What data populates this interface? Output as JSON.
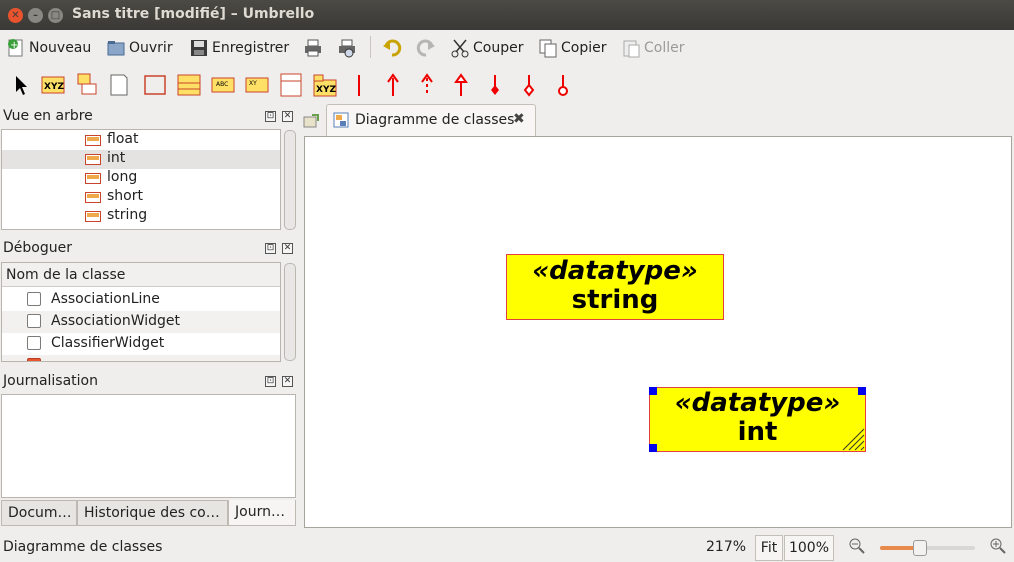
{
  "window": {
    "title": "Sans titre [modifié] – Umbrello"
  },
  "toolbar": {
    "new_label": "Nouveau",
    "open_label": "Ouvrir",
    "save_label": "Enregistrer",
    "cut_label": "Couper",
    "copy_label": "Copier",
    "paste_label": "Coller"
  },
  "tree_panel": {
    "title": "Vue en arbre",
    "items": [
      {
        "label": "float"
      },
      {
        "label": "int"
      },
      {
        "label": "long"
      },
      {
        "label": "short"
      },
      {
        "label": "string"
      }
    ]
  },
  "debug_panel": {
    "title": "Déboguer",
    "column_header": "Nom de la classe",
    "items": [
      {
        "label": "AssociationLine"
      },
      {
        "label": "AssociationWidget"
      },
      {
        "label": "ClassifierWidget"
      }
    ]
  },
  "log_panel": {
    "title": "Journalisation"
  },
  "bottom_tabs": [
    {
      "label": "Docum…"
    },
    {
      "label": "Historique des co…"
    },
    {
      "label": "Journ…"
    }
  ],
  "diagram": {
    "tab_label": "Diagramme de classes",
    "widgets": [
      {
        "stereotype": "«datatype»",
        "name": "string"
      },
      {
        "stereotype": "«datatype»",
        "name": "int"
      }
    ]
  },
  "status": {
    "text": "Diagramme de classes",
    "zoom": "217%",
    "fit_label": "Fit",
    "reset_label": "100%"
  },
  "colors": {
    "datatype_fill": "#ffff00",
    "datatype_border": "#e04040",
    "selection_handle": "#0000ee"
  }
}
